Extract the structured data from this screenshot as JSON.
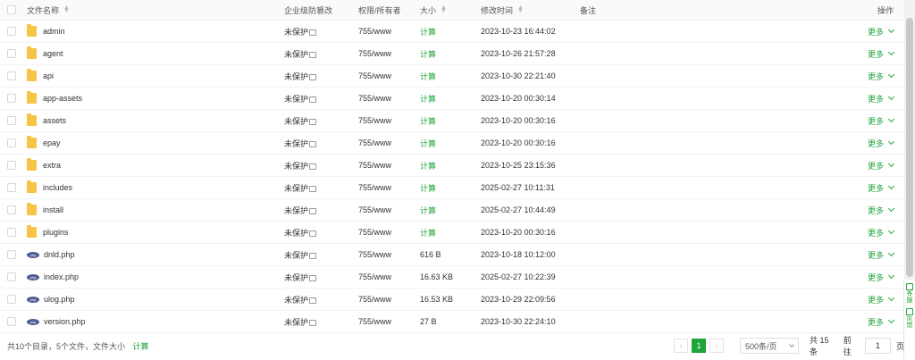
{
  "header": {
    "name": "文件名称",
    "protect": "企业级防篡改",
    "perm": "权限/所有者",
    "size": "大小",
    "time": "修改时间",
    "note": "备注",
    "action": "操作"
  },
  "rows": [
    {
      "type": "folder",
      "name": "admin",
      "protect": "未保护",
      "perm": "755/www",
      "size": "计算",
      "time": "2023-10-23 16:44:02",
      "more": "更多"
    },
    {
      "type": "folder",
      "name": "agent",
      "protect": "未保护",
      "perm": "755/www",
      "size": "计算",
      "time": "2023-10-26 21:57:28",
      "more": "更多"
    },
    {
      "type": "folder",
      "name": "api",
      "protect": "未保护",
      "perm": "755/www",
      "size": "计算",
      "time": "2023-10-30 22:21:40",
      "more": "更多"
    },
    {
      "type": "folder",
      "name": "app-assets",
      "protect": "未保护",
      "perm": "755/www",
      "size": "计算",
      "time": "2023-10-20 00:30:14",
      "more": "更多"
    },
    {
      "type": "folder",
      "name": "assets",
      "protect": "未保护",
      "perm": "755/www",
      "size": "计算",
      "time": "2023-10-20 00:30:16",
      "more": "更多"
    },
    {
      "type": "folder",
      "name": "epay",
      "protect": "未保护",
      "perm": "755/www",
      "size": "计算",
      "time": "2023-10-20 00:30:16",
      "more": "更多"
    },
    {
      "type": "folder",
      "name": "extra",
      "protect": "未保护",
      "perm": "755/www",
      "size": "计算",
      "time": "2023-10-25 23:15:36",
      "more": "更多"
    },
    {
      "type": "folder",
      "name": "includes",
      "protect": "未保护",
      "perm": "755/www",
      "size": "计算",
      "time": "2025-02-27 10:11:31",
      "more": "更多"
    },
    {
      "type": "folder",
      "name": "install",
      "protect": "未保护",
      "perm": "755/www",
      "size": "计算",
      "time": "2025-02-27 10:44:49",
      "more": "更多"
    },
    {
      "type": "folder",
      "name": "plugins",
      "protect": "未保护",
      "perm": "755/www",
      "size": "计算",
      "time": "2023-10-20 00:30:16",
      "more": "更多"
    },
    {
      "type": "php",
      "name": "dnld.php",
      "protect": "未保护",
      "perm": "755/www",
      "size": "616 B",
      "time": "2023-10-18 10:12:00",
      "more": "更多"
    },
    {
      "type": "php",
      "name": "index.php",
      "protect": "未保护",
      "perm": "755/www",
      "size": "16.63 KB",
      "time": "2025-02-27 10:22:39",
      "more": "更多"
    },
    {
      "type": "php",
      "name": "ulog.php",
      "protect": "未保护",
      "perm": "755/www",
      "size": "16.53 KB",
      "time": "2023-10-29 22:09:56",
      "more": "更多"
    },
    {
      "type": "php",
      "name": "version.php",
      "protect": "未保护",
      "perm": "755/www",
      "size": "27 B",
      "time": "2023-10-30 22:24:10",
      "more": "更多"
    }
  ],
  "php_badge": "php",
  "footer": {
    "summary": "共10个目录，5个文件，文件大小",
    "calc": "计算",
    "current_page": "1",
    "page_size": "500条/页",
    "total": "共 15 条",
    "goto_label": "前往",
    "goto_value": "1",
    "page_unit": "页"
  },
  "side_panel": {
    "label1": "客服",
    "label2": "反馈"
  },
  "colors": {
    "accent": "#20a53a",
    "folder": "#f7c545",
    "php": "#4f5b93"
  }
}
